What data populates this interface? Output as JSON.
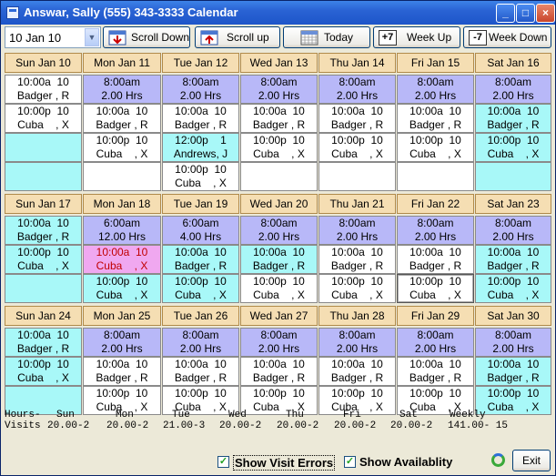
{
  "window": {
    "title": "Answar, Sally (555) 343-3333 Calendar"
  },
  "toolbar": {
    "date_value": "10 Jan 10",
    "scroll_down": "Scroll Down",
    "scroll_up": "Scroll up",
    "today": "Today",
    "week_up": "Week Up",
    "week_down": "Week Down",
    "week_up_icon_text": "+7",
    "week_down_icon_text": "-7"
  },
  "weeks": [
    {
      "days": [
        "Sun Jan 10",
        "Mon Jan 11",
        "Tue Jan 12",
        "Wed Jan 13",
        "Thu Jan 14",
        "Fri Jan 15",
        "Sat Jan 16"
      ],
      "rows": [
        [
          [
            "10:00a  10",
            "Badger , R",
            "white"
          ],
          [
            "8:00am",
            "2.00 Hrs",
            "blue"
          ],
          [
            "8:00am",
            "2.00 Hrs",
            "blue"
          ],
          [
            "8:00am",
            "2.00 Hrs",
            "blue"
          ],
          [
            "8:00am",
            "2.00 Hrs",
            "blue"
          ],
          [
            "8:00am",
            "2.00 Hrs",
            "blue"
          ],
          [
            "8:00am",
            "2.00 Hrs",
            "blue"
          ]
        ],
        [
          [
            "10:00p  10",
            "Cuba    , X",
            "white"
          ],
          [
            "10:00a  10",
            "Badger , R",
            "white"
          ],
          [
            "10:00a  10",
            "Badger , R",
            "white"
          ],
          [
            "10:00a  10",
            "Badger , R",
            "white"
          ],
          [
            "10:00a  10",
            "Badger , R",
            "white"
          ],
          [
            "10:00a  10",
            "Badger , R",
            "white"
          ],
          [
            "10:00a  10",
            "Badger , R",
            "cyan"
          ]
        ],
        [
          [
            "",
            "",
            "cyan"
          ],
          [
            "10:00p  10",
            "Cuba    , X",
            "white"
          ],
          [
            "12:00p    1",
            "Andrews, J",
            "cyan"
          ],
          [
            "10:00p  10",
            "Cuba    , X",
            "white"
          ],
          [
            "10:00p  10",
            "Cuba    , X",
            "white"
          ],
          [
            "10:00p  10",
            "Cuba    , X",
            "white"
          ],
          [
            "10:00p  10",
            "Cuba    , X",
            "cyan"
          ]
        ],
        [
          [
            "",
            "",
            "cyan"
          ],
          [
            "",
            "",
            "white"
          ],
          [
            "10:00p  10",
            "Cuba    , X",
            "white"
          ],
          [
            "",
            "",
            "white"
          ],
          [
            "",
            "",
            "white"
          ],
          [
            "",
            "",
            "white"
          ],
          [
            "",
            "",
            "cyan"
          ]
        ]
      ]
    },
    {
      "days": [
        "Sun Jan 17",
        "Mon Jan 18",
        "Tue Jan 19",
        "Wed Jan 20",
        "Thu Jan 21",
        "Fri Jan 22",
        "Sat Jan 23"
      ],
      "rows": [
        [
          [
            "10:00a  10",
            "Badger , R",
            "cyan"
          ],
          [
            "6:00am",
            "12.00 Hrs",
            "blue"
          ],
          [
            "6:00am",
            "4.00 Hrs",
            "blue"
          ],
          [
            "8:00am",
            "2.00 Hrs",
            "blue"
          ],
          [
            "8:00am",
            "2.00 Hrs",
            "blue"
          ],
          [
            "8:00am",
            "2.00 Hrs",
            "blue"
          ],
          [
            "8:00am",
            "2.00 Hrs",
            "blue"
          ]
        ],
        [
          [
            "10:00p  10",
            "Cuba    , X",
            "cyan"
          ],
          [
            "10:00a  10",
            "Cuba    , X",
            "pink"
          ],
          [
            "10:00a  10",
            "Badger , R",
            "cyan"
          ],
          [
            "10:00a  10",
            "Badger , R",
            "cyan"
          ],
          [
            "10:00a  10",
            "Badger , R",
            "white"
          ],
          [
            "10:00a  10",
            "Badger , R",
            "white"
          ],
          [
            "10:00a  10",
            "Badger , R",
            "cyan"
          ]
        ],
        [
          [
            "",
            "",
            "cyan"
          ],
          [
            "10:00p  10",
            "Cuba    , X",
            "cyan"
          ],
          [
            "10:00p  10",
            "Cuba    , X",
            "cyan"
          ],
          [
            "10:00p  10",
            "Cuba    , X",
            "white"
          ],
          [
            "10:00p  10",
            "Cuba    , X",
            "white"
          ],
          [
            "10:00p  10",
            "Cuba    , X",
            "sel"
          ],
          [
            "10:00p  10",
            "Cuba    , X",
            "cyan"
          ]
        ]
      ]
    },
    {
      "days": [
        "Sun Jan 24",
        "Mon Jan 25",
        "Tue Jan 26",
        "Wed Jan 27",
        "Thu Jan 28",
        "Fri Jan 29",
        "Sat Jan 30"
      ],
      "rows": [
        [
          [
            "10:00a  10",
            "Badger , R",
            "cyan"
          ],
          [
            "8:00am",
            "2.00 Hrs",
            "blue"
          ],
          [
            "8:00am",
            "2.00 Hrs",
            "blue"
          ],
          [
            "8:00am",
            "2.00 Hrs",
            "blue"
          ],
          [
            "8:00am",
            "2.00 Hrs",
            "blue"
          ],
          [
            "8:00am",
            "2.00 Hrs",
            "blue"
          ],
          [
            "8:00am",
            "2.00 Hrs",
            "blue"
          ]
        ],
        [
          [
            "10:00p  10",
            "Cuba    , X",
            "cyan"
          ],
          [
            "10:00a  10",
            "Badger , R",
            "white"
          ],
          [
            "10:00a  10",
            "Badger , R",
            "white"
          ],
          [
            "10:00a  10",
            "Badger , R",
            "white"
          ],
          [
            "10:00a  10",
            "Badger , R",
            "white"
          ],
          [
            "10:00a  10",
            "Badger , R",
            "white"
          ],
          [
            "10:00a  10",
            "Badger , R",
            "cyan"
          ]
        ],
        [
          [
            "",
            "",
            "cyan"
          ],
          [
            "10:00p  10",
            "Cuba    , X",
            "white"
          ],
          [
            "10:00p  10",
            "Cuba    , X",
            "white"
          ],
          [
            "10:00p  10",
            "Cuba    , X",
            "white"
          ],
          [
            "10:00p  10",
            "Cuba    , X",
            "white"
          ],
          [
            "10:00p  10",
            "Cuba    , X",
            "white"
          ],
          [
            "10:00p  10",
            "Cuba    , X",
            "cyan"
          ]
        ]
      ]
    }
  ],
  "summary": {
    "row1_label": "Hours-",
    "row2_label": "Visits",
    "columns": [
      {
        "day": "Sun",
        "value": "20.00-2"
      },
      {
        "day": "Mon",
        "value": "20.00-2"
      },
      {
        "day": "Tue",
        "value": "21.00-3"
      },
      {
        "day": "Wed",
        "value": "20.00-2"
      },
      {
        "day": "Thu",
        "value": "20.00-2"
      },
      {
        "day": "Fri",
        "value": "20.00-2"
      },
      {
        "day": "Sat",
        "value": "20.00-2"
      },
      {
        "day": "Weekly",
        "value": "141.00- 15"
      }
    ]
  },
  "options": {
    "show_visit_errors": "Show Visit Errors",
    "show_availability": "Show Availablity",
    "check_mark": "✓",
    "exit": "Exit"
  },
  "colors": {
    "blue": "#b8b8f8",
    "cyan": "#a8f8f8",
    "pink": "#f0a8f0",
    "header": "#f5deb3"
  }
}
